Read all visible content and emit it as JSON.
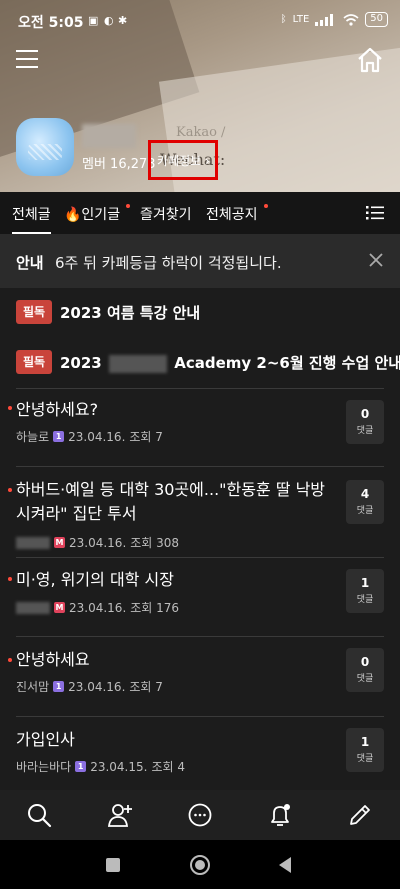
{
  "status_bar": {
    "time": "오전 5:05",
    "battery": "50",
    "network": "LTE"
  },
  "header": {
    "member_count": "멤버 16,273",
    "cafe_info_label": "카페정보 ›",
    "background_text": "Wechat:",
    "background_text_faint": "Kakao /"
  },
  "tabs": [
    {
      "label": "전체글",
      "active": true,
      "dot": false
    },
    {
      "label": "🔥인기글",
      "active": false,
      "dot": true
    },
    {
      "label": "즐겨찾기",
      "active": false,
      "dot": false
    },
    {
      "label": "전체공지",
      "active": false,
      "dot": true
    }
  ],
  "notice": {
    "tag": "안내",
    "text": "6주 뒤 카페등급 하락이 걱정됩니다."
  },
  "pinned": [
    {
      "badge": "필독",
      "title": "2023 여름 특강 안내"
    },
    {
      "badge": "필독",
      "title_prefix": "2023",
      "title_suffix": "Academy 2~6월 진행 수업 안내"
    }
  ],
  "posts": [
    {
      "title": "안녕하세요?",
      "author": "하늘로",
      "level": "1",
      "date": "23.04.16.",
      "views": "조회 7",
      "comments": "0",
      "comment_label": "댓글",
      "new": true
    },
    {
      "title": "하버드·예일 등 대학 30곳에...\"한동훈 딸 낙방시켜라\" 집단 투서",
      "author": "",
      "level": "M",
      "date": "23.04.16.",
      "views": "조회 308",
      "comments": "4",
      "comment_label": "댓글",
      "new": true
    },
    {
      "title": "미·영, 위기의 대학 시장",
      "author": "",
      "level": "M",
      "date": "23.04.16.",
      "views": "조회 176",
      "comments": "1",
      "comment_label": "댓글",
      "new": true
    },
    {
      "title": "안녕하세요",
      "author": "진서맘",
      "level": "1",
      "date": "23.04.16.",
      "views": "조회 7",
      "comments": "0",
      "comment_label": "댓글",
      "new": true
    },
    {
      "title": "가입인사",
      "author": "바라는바다",
      "level": "1",
      "date": "23.04.15.",
      "views": "조회 4",
      "comments": "1",
      "comment_label": "댓글",
      "new": false
    }
  ],
  "icons": {
    "menu": "menu-icon",
    "home": "home-icon",
    "list": "list-view-icon",
    "close": "close-icon",
    "bottom": [
      "search-icon",
      "add-member-icon",
      "chat-icon",
      "notification-settings-icon",
      "write-icon"
    ]
  },
  "colors": {
    "accent_red": "#c9443b",
    "new_dot": "#ff4a3a",
    "highlight_box": "#e00000",
    "level_one": "#8b6fe0",
    "level_manager": "#e0435c"
  }
}
